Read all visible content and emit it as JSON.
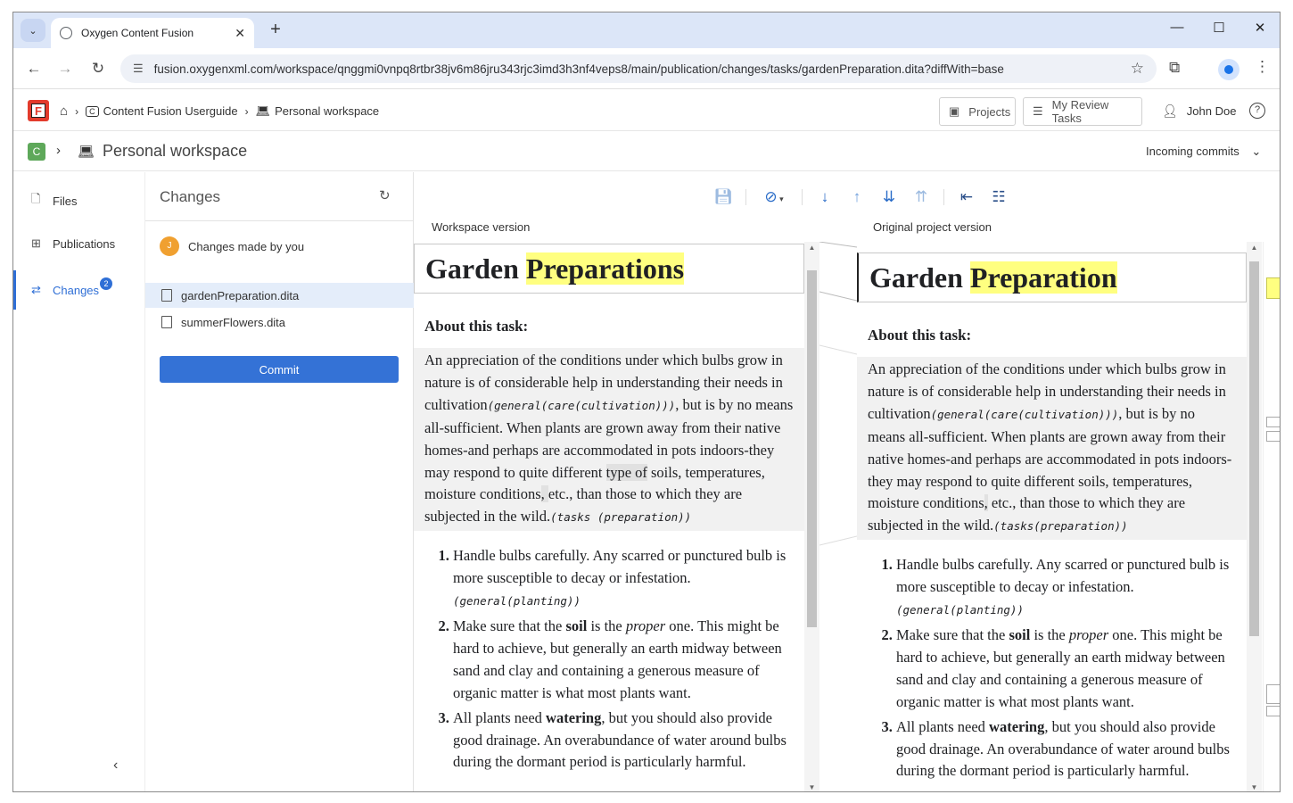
{
  "browser": {
    "tab_title": "Oxygen Content Fusion",
    "url": "fusion.oxygenxml.com/workspace/qnggmi0vnpq8rtbr38jv6m86jru343rjc3imd3h3nf4veps8/main/publication/changes/tasks/gardenPreparation.dita?diffWith=base"
  },
  "header": {
    "breadcrumb_1": "Content Fusion Userguide",
    "breadcrumb_2": "Personal workspace",
    "projects_label": "Projects",
    "review_label": "My Review Tasks",
    "user_name": "John Doe"
  },
  "project": {
    "badge": "C",
    "title": "Personal workspace",
    "incoming": "Incoming commits"
  },
  "sidebar": {
    "items": [
      {
        "label": "Files"
      },
      {
        "label": "Publications"
      },
      {
        "label": "Changes",
        "badge": "2"
      }
    ]
  },
  "changes": {
    "title": "Changes",
    "owner_initial": "J",
    "owner_label": "Changes made by you",
    "files": [
      "gardenPreparation.dita",
      "summerFlowers.dita"
    ],
    "commit_label": "Commit"
  },
  "diff": {
    "left_label": "Workspace version",
    "right_label": "Original project version",
    "left": {
      "title_pre": "Garden ",
      "title_hl": "Preparations",
      "about": "About this task:",
      "sd_1": "An appreciation of the conditions under which bulbs grow in nature is of considerable help in understanding their needs in cultivation",
      "sd_m1": "(general(care(cultivation)))",
      "sd_2": ", but is by no means all-sufficient. When plants are grown away from their native homes-and perhaps are accommodated in pots indoors-they may respond to quite different ",
      "sd_chg": "type of",
      "sd_3": " soils, temperatures, moisture conditions",
      "sd_chg2": ", ",
      "sd_4": "etc., than those to which they are subjected in the wild.",
      "sd_m2": "(tasks (preparation))"
    },
    "right": {
      "title_pre": "Garden ",
      "title_hl": "Preparation",
      "about": "About this task:",
      "sd_1": "An appreciation of the conditions under which bulbs grow in nature is of considerable help in understanding their needs in cultivation",
      "sd_m1": "(general(care(cultivation)))",
      "sd_2": ", but is by no means all-sufficient. When plants are grown away from their native homes-and perhaps are accommodated in pots indoors-they may respond to quite different ",
      "sd_3": "soils, temperatures, moisture conditions",
      "sd_chg2": ",",
      "sd_4": " etc., than those to which they are subjected in the wild.",
      "sd_m2": "(tasks(preparation))"
    },
    "steps": {
      "s1": "Handle bulbs carefully. Any scarred or punctured bulb is more susceptible to decay or infestation. ",
      "s1_m": "(general(planting))",
      "s2_a": "Make sure that the ",
      "s2_b": "soil",
      "s2_c": " is the ",
      "s2_d": "proper",
      "s2_e": " one. This might be hard to achieve, but generally an earth midway between sand and clay and containing a generous measure of organic matter is what most plants want.",
      "s3_a": "All plants need ",
      "s3_b": "watering",
      "s3_c": ", but you should also provide good drainage. An overabundance of water around bulbs during the dormant period is particularly harmful."
    }
  },
  "colors": {
    "accent": "#3472d6",
    "highlight": "#ffff80",
    "changed_bg": "#e1e1e1"
  }
}
